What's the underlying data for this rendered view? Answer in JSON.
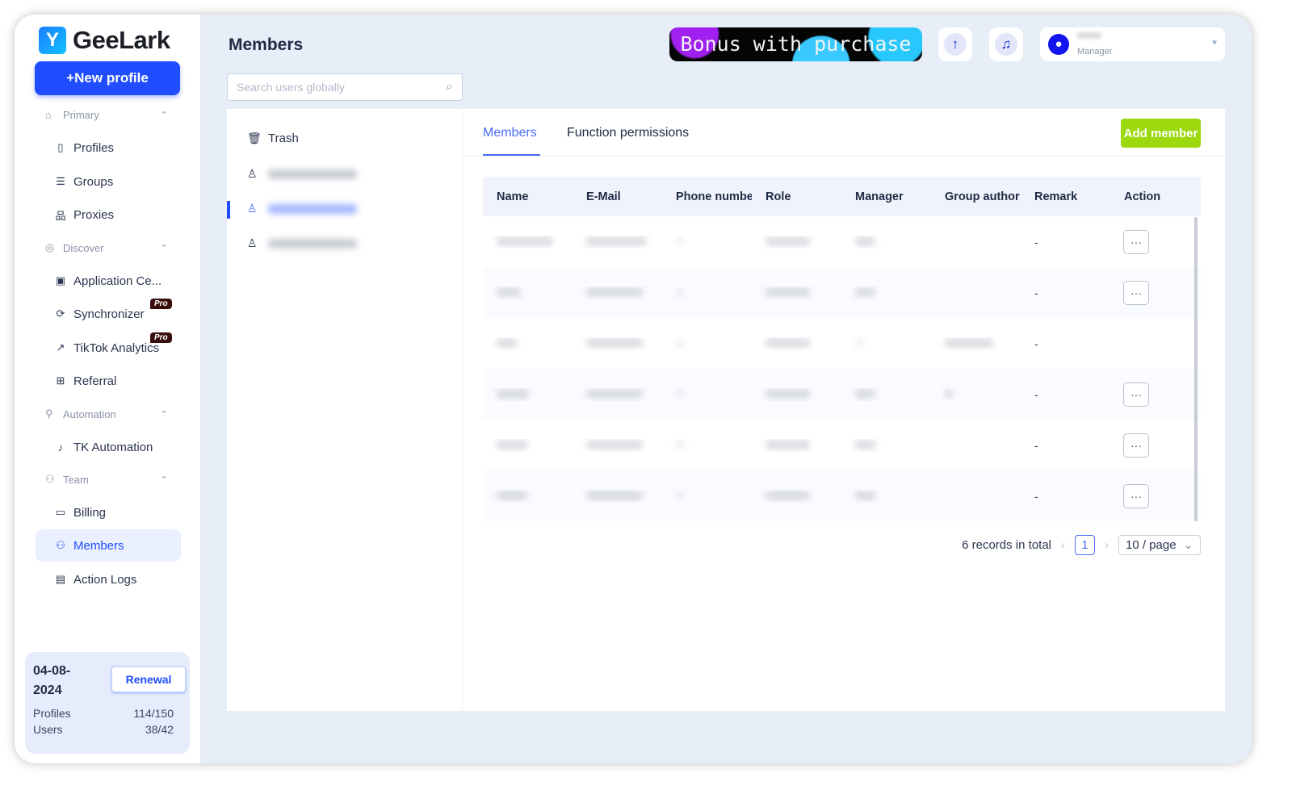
{
  "brand": {
    "name": "GeeLark"
  },
  "sidebar": {
    "new_profile": "+New profile",
    "sections": [
      {
        "label": "Primary",
        "items": [
          "Profiles",
          "Groups",
          "Proxies"
        ]
      },
      {
        "label": "Discover",
        "items": [
          "Application Ce...",
          "Synchronizer",
          "TikTok Analytics",
          "Referral"
        ]
      },
      {
        "label": "Automation",
        "items": [
          "TK Automation"
        ]
      },
      {
        "label": "Team",
        "items": [
          "Billing",
          "Members",
          "Action Logs"
        ]
      }
    ],
    "pro_badge": "Pro",
    "active_item": "Members",
    "plan": {
      "date": "04-08-2024",
      "renewal": "Renewal",
      "profiles_label": "Profiles",
      "profiles_value": "114/150",
      "users_label": "Users",
      "users_value": "38/42"
    }
  },
  "header": {
    "title": "Members",
    "search_placeholder": "Search users globally",
    "banner": "Bonus with purchase",
    "user_role": "Manager"
  },
  "left_panel": {
    "trash": "Trash"
  },
  "tabs": [
    "Members",
    "Function permissions"
  ],
  "add_member": "Add member",
  "table": {
    "columns": [
      "Name",
      "E-Mail",
      "Phone number",
      "Role",
      "Manager",
      "Group author",
      "Remark",
      "Action"
    ],
    "rows": [
      {
        "remark": "-",
        "has_action": true,
        "action": "···"
      },
      {
        "remark": "-",
        "has_action": true,
        "action": "···"
      },
      {
        "remark": "-",
        "has_action": false,
        "action": ""
      },
      {
        "remark": "-",
        "has_action": true,
        "action": "···"
      },
      {
        "remark": "-",
        "has_action": true,
        "action": "···"
      },
      {
        "remark": "-",
        "has_action": true,
        "action": "···"
      }
    ]
  },
  "pagination": {
    "total": "6 records in total",
    "current": "1",
    "page_size": "10 / page"
  },
  "colors": {
    "primary": "#1f4dff",
    "accent_green": "#9bd80e",
    "tab_active": "#4a6cf7",
    "bg": "#e8eef8"
  }
}
